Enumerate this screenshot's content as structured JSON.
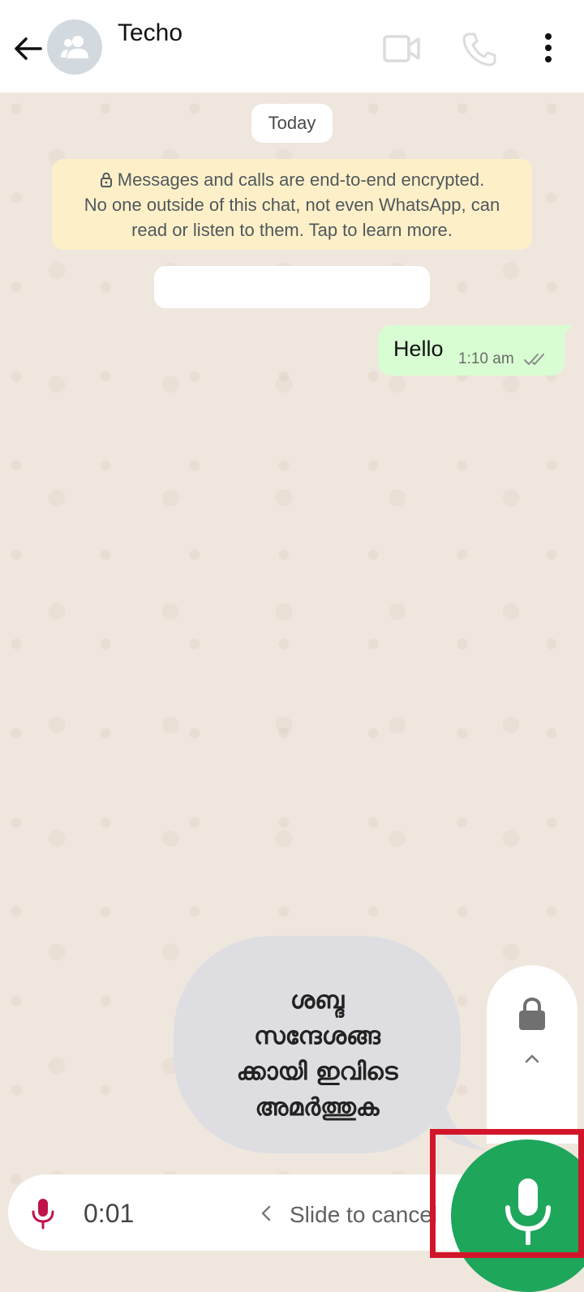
{
  "header": {
    "contact_name": "Techo",
    "icons": {
      "back": "arrow-left-icon",
      "avatar": "group-avatar-icon",
      "video": "video-call-icon",
      "call": "phone-icon",
      "menu": "more-vertical-icon"
    }
  },
  "chat": {
    "date_chip": "Today",
    "encryption_notice": {
      "line1": "Messages and calls are end-to-end encrypted.",
      "line2": "No one outside of this chat, not even WhatsApp, can",
      "line3": "read or listen to them. Tap to learn more."
    },
    "messages": [
      {
        "direction": "outgoing",
        "text": "Hello",
        "time": "1:10 am",
        "status": "read-ticks"
      }
    ]
  },
  "tooltip": {
    "lines": [
      "ശബ്ദ",
      "സന്ദേശങ്ങ",
      "ക്കായി ഇവിടെ",
      "അമർത്തുക"
    ]
  },
  "recording_bar": {
    "elapsed": "0:01",
    "slide_to_cancel": "Slide to cancel"
  },
  "colors": {
    "header_bg": "#ffffff",
    "chat_bg": "#efe7de",
    "outgoing_bubble": "#d8fdd2",
    "notice_bg": "#fdf0c9",
    "accent_green": "#1ea65b",
    "recording_red": "#c0134a",
    "highlight_red": "#d3152b"
  }
}
